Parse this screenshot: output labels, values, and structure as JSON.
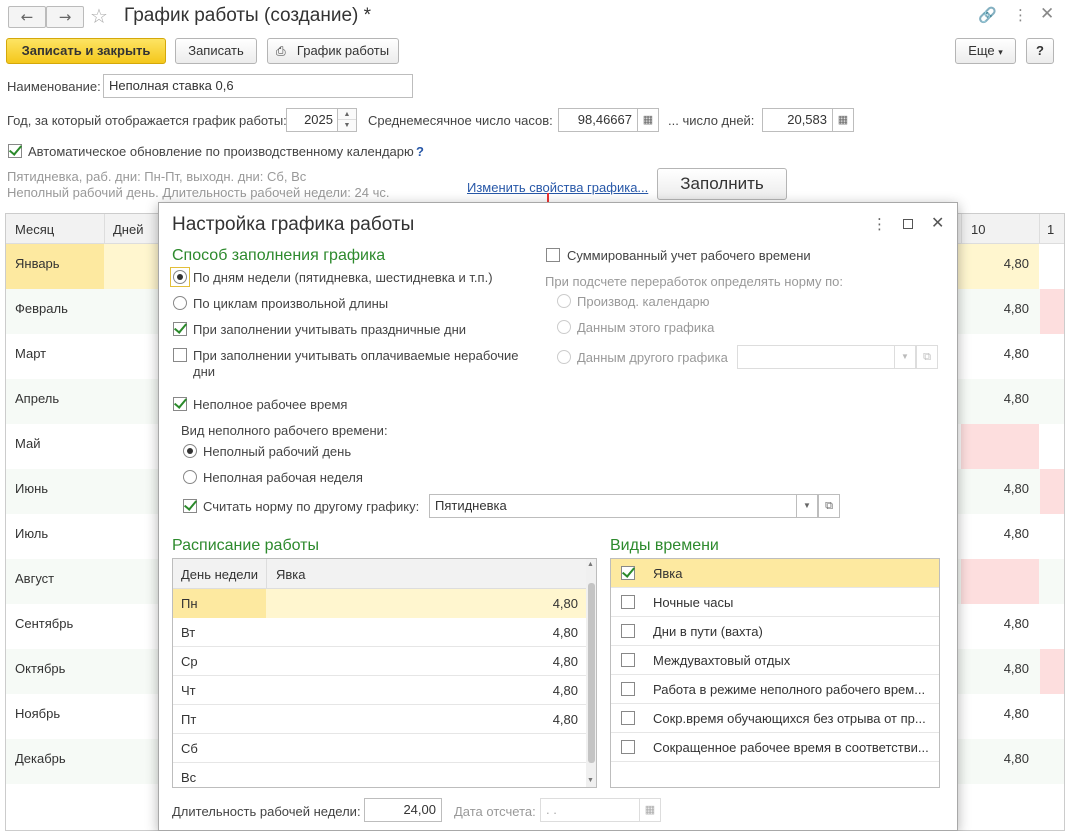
{
  "window": {
    "title": "График работы (создание) *"
  },
  "toolbar": {
    "save_close": "Записать и закрыть",
    "save": "Записать",
    "schedule": "График работы",
    "more": "Еще",
    "help": "?"
  },
  "form": {
    "name_label": "Наименование:",
    "name_value": "Неполная ставка 0,6",
    "year_label": "Год, за который отображается график работы:",
    "year_value": "2025",
    "avg_hours_label": "Среднемесячное число часов:",
    "avg_hours_value": "98,46667",
    "days_label": "... число дней:",
    "days_value": "20,583",
    "auto_update_label": "Автоматическое обновление по производственному календарю",
    "auto_update_help": "?",
    "info_line1": "Пятидневка, раб. дни: Пн-Пт, выходн. дни: Сб, Вс",
    "info_line2": "Неполный рабочий день. Длительность рабочей недели: 24 чс.",
    "change_link": "Изменить свойства графика...",
    "fill_button": "Заполнить"
  },
  "months_grid": {
    "col_month": "Месяц",
    "col_days": "Дней",
    "col_10": "10",
    "col_11": "1",
    "rows": [
      {
        "month": "Январь",
        "value": "4,80"
      },
      {
        "month": "Февраль",
        "value": "4,80"
      },
      {
        "month": "Март",
        "value": "4,80"
      },
      {
        "month": "Апрель",
        "value": "4,80"
      },
      {
        "month": "Май",
        "value": ""
      },
      {
        "month": "Июнь",
        "value": "4,80"
      },
      {
        "month": "Июль",
        "value": "4,80"
      },
      {
        "month": "Август",
        "value": ""
      },
      {
        "month": "Сентябрь",
        "value": "4,80"
      },
      {
        "month": "Октябрь",
        "value": "4,80"
      },
      {
        "month": "Ноябрь",
        "value": "4,80"
      },
      {
        "month": "Декабрь",
        "value": "4,80"
      }
    ]
  },
  "dialog": {
    "title": "Настройка графика работы",
    "fill_method_title": "Способ заполнения графика",
    "by_weekdays": "По дням недели (пятидневка, шестидневка и т.п.)",
    "by_cycles": "По циклам произвольной длины",
    "holidays": "При заполнении учитывать праздничные дни",
    "paid_nonworking_1": "При заполнении учитывать оплачиваемые нерабочие",
    "paid_nonworking_2": "дни",
    "summary_label": "Суммированный учет рабочего времени",
    "norm_label": "При подсчете переработок определять норму по:",
    "norm_opt1": "Производ. календарю",
    "norm_opt2": "Данным этого графика",
    "norm_opt3": "Данным другого графика",
    "part_time": "Неполное рабочее время",
    "part_type_label": "Вид неполного рабочего времени:",
    "part_day": "Неполный рабочий день",
    "part_week": "Неполная рабочая неделя",
    "norm_other": "Считать норму по другому графику:",
    "norm_other_value": "Пятидневка",
    "schedule_title": "Расписание работы",
    "schedule_col_day": "День недели",
    "schedule_col_attend": "Явка",
    "schedule_rows": [
      {
        "day": "Пн",
        "hours": "4,80"
      },
      {
        "day": "Вт",
        "hours": "4,80"
      },
      {
        "day": "Ср",
        "hours": "4,80"
      },
      {
        "day": "Чт",
        "hours": "4,80"
      },
      {
        "day": "Пт",
        "hours": "4,80"
      },
      {
        "day": "Сб",
        "hours": ""
      },
      {
        "day": "Вс",
        "hours": ""
      }
    ],
    "time_types_title": "Виды времени",
    "time_types": [
      {
        "label": "Явка",
        "checked": true
      },
      {
        "label": "Ночные часы",
        "checked": false
      },
      {
        "label": "Дни в пути (вахта)",
        "checked": false
      },
      {
        "label": "Междувахтовый отдых",
        "checked": false
      },
      {
        "label": "Работа в режиме неполного рабочего врем...",
        "checked": false
      },
      {
        "label": "Сокр.время обучающихся без отрыва от пр...",
        "checked": false
      },
      {
        "label": "Сокращенное рабочее время в соответстви...",
        "checked": false
      }
    ],
    "week_len_label": "Длительность рабочей недели:",
    "week_len_value": "24,00",
    "ref_date_label": "Дата отсчета:",
    "ref_date_value": " .  ."
  },
  "colors": {
    "primary_button": "#f4c71b",
    "selected_row": "#fde9a0",
    "section_title": "#2d8a2d",
    "link": "#2858a8",
    "weekend_highlight": "#fddede"
  }
}
